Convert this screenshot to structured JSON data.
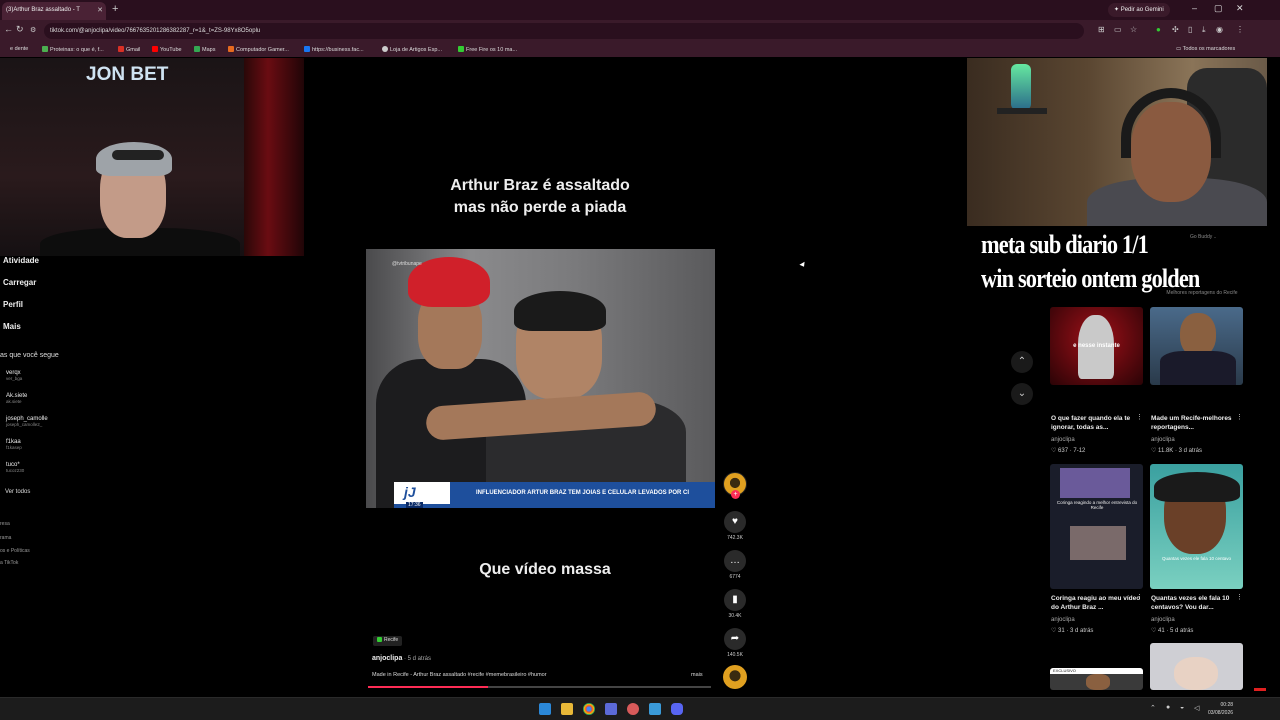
{
  "browser": {
    "tab_title": "(3)Arthur Braz assaltado - T",
    "url": "tiktok.com/@anjoclipa/video/7667635201286382287_r=1&_t=ZS-98Yx8O5oplu",
    "gemini_label": "Pedir ao Gemini",
    "bookmarks": [
      "e dente",
      "Proteinas: o que é, f...",
      "Gmail",
      "YouTube",
      "Maps",
      "Computador Gamer...",
      "https://business.fac...",
      "Loja de Artigos Esp...",
      "Free Fire os 10 ma..."
    ],
    "all_bookmarks": "Todos os marcadores",
    "bookmark_colors": [
      "#888888",
      "#4caf50",
      "#d93025",
      "#ff0000",
      "#34a853",
      "#e66a1f",
      "#1877f2",
      "#cccccc",
      "#3c3"
    ]
  },
  "stream": {
    "brand": "JON BET",
    "overlay_line1": "meta sub diario 1/1",
    "overlay_line2": "win sorteio ontem golden"
  },
  "sidebar": {
    "items": [
      "Atividade",
      "Carregar",
      "Perfil",
      "Mais"
    ],
    "following_header": "as que você segue",
    "following": [
      {
        "name": "verqx",
        "handle": "ver_bga"
      },
      {
        "name": "Ak.siete",
        "handle": "ak.siete"
      },
      {
        "name": "joseph_camolle",
        "handle": "joseph_camolle2_"
      },
      {
        "name": "f1kaa",
        "handle": "f1kasep"
      },
      {
        "name": "tuco*",
        "handle": "tucoz230"
      }
    ],
    "see_all": "Ver todos",
    "footer": [
      "resa",
      "rama",
      "os e Políticas",
      "a TikTok"
    ]
  },
  "video": {
    "title_line1": "Arthur Braz é assaltado",
    "title_line2": "mas não perde a piada",
    "watermark": "@tvtribunape",
    "ticker_logo": "jJ",
    "ticker_time": "17:36",
    "ticker_text": "INFLUENCIADOR ARTUR BRAZ TEM JOIAS E CELULAR LEVADOS POR CI",
    "caption": "Que vídeo massa",
    "tag": "Recife",
    "author": "anjoclipa",
    "posted": " · 5 d atrás",
    "description": "Made in Recife - Arthur Braz assaltado #recife #memebrasileiro #humor",
    "more": "mais",
    "progress": 0.35
  },
  "actions": {
    "plus": "+",
    "likes": "742.3K",
    "comments": "6774",
    "saves": "30.4K",
    "shares": "140.5K"
  },
  "related": [
    {
      "title": "O que fazer quando ela te ignorar, todas as...",
      "author": "anjoclipa",
      "stats": "637 · 7-12",
      "thumb_text": "e nesse instante"
    },
    {
      "title": "Made um Recife-melhores reportagens...",
      "author": "anjoclipa",
      "stats": "11.8K · 3 d atrás",
      "thumb_text": "Melhores Reportagens de Recife"
    },
    {
      "title": "Coringa reagiu ao meu vídeo do Arthur Braz ...",
      "author": "anjoclipa",
      "stats": "31 · 3 d atrás",
      "thumb_text": "Coringa reagindo a melhor entrevista do Recife"
    },
    {
      "title": "Quantas vezes ele fala 10 centavos? Vou dar...",
      "author": "anjoclipa",
      "stats": "41 · 5 d atrás",
      "thumb_text": "Quantas vezes ele fala 10 centavo"
    },
    {
      "title": "",
      "author": "",
      "stats": "",
      "thumb_text": "EXCLUSIVO"
    },
    {
      "title": "",
      "author": "",
      "stats": "",
      "thumb_text": ""
    }
  ],
  "related_top_fragment": [
    "Go Buddy ..",
    "Melhores reportagens do Recife"
  ],
  "taskbar": {
    "time": "00:28",
    "date": "03/08/2026"
  }
}
